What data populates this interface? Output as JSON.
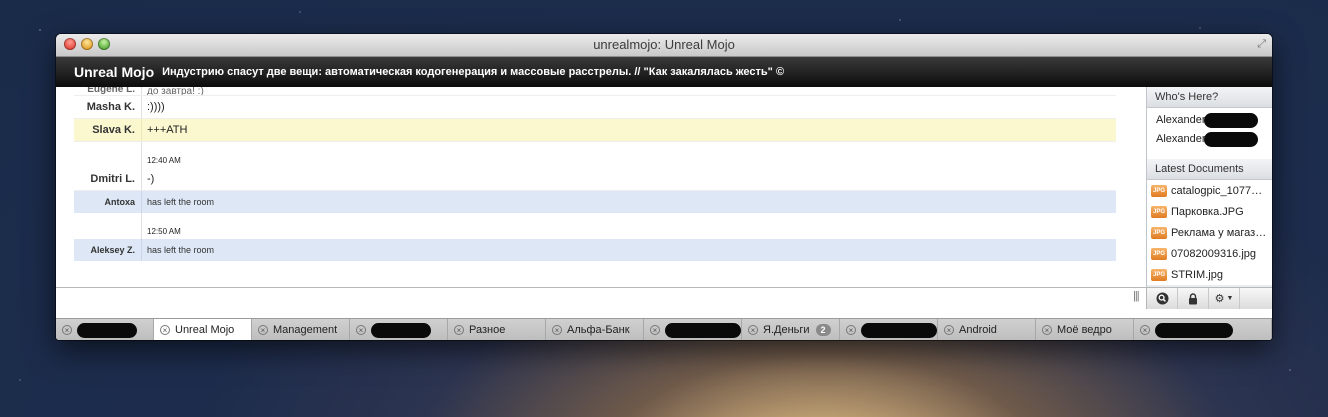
{
  "window": {
    "title": "unrealmojo: Unreal Mojo"
  },
  "header": {
    "room_name": "Unreal Mojo",
    "topic": "Индустрию спасут две вещи: автоматическая кодогенерация и массовые расстрелы. // \"Как закалялась жесть\" ©"
  },
  "chat": {
    "partial": {
      "name": "Eugene L.",
      "text": "до завтра! :)"
    },
    "m1": {
      "name": "Masha K.",
      "text": ":))))"
    },
    "m2": {
      "name": "Slava K.",
      "text": "+++ATH"
    },
    "t1": "12:40 AM",
    "m3": {
      "name": "Dmitri L.",
      "text": "-)"
    },
    "s1": {
      "name": "Antoxa",
      "text": "has left the room"
    },
    "t2": "12:50 AM",
    "s2": {
      "name": "Aleksey Z.",
      "text": "has left the room"
    }
  },
  "sidebar": {
    "who_header": "Who's Here?",
    "who": [
      "Alexander",
      "Alexander"
    ],
    "docs_header": "Latest Documents",
    "docs": [
      "catalogpic_1077…",
      "Парковка.JPG",
      "Реклама у магаз…",
      "07082009316.jpg",
      "STRIM.jpg"
    ]
  },
  "input": {
    "value": ""
  },
  "tabs": [
    {
      "label": ""
    },
    {
      "label": "Unreal Mojo",
      "active": true
    },
    {
      "label": "Management"
    },
    {
      "label": ""
    },
    {
      "label": "Разное"
    },
    {
      "label": "Альфа-Банк"
    },
    {
      "label": ""
    },
    {
      "label": "Я.Деньги",
      "badge": "2"
    },
    {
      "label": ""
    },
    {
      "label": "Android"
    },
    {
      "label": "Моё ведро"
    },
    {
      "label": ""
    }
  ],
  "colors": {
    "highlight": "#fbf8d0",
    "system": "#dde7f5",
    "topic_bar": "#0c0c0c"
  }
}
